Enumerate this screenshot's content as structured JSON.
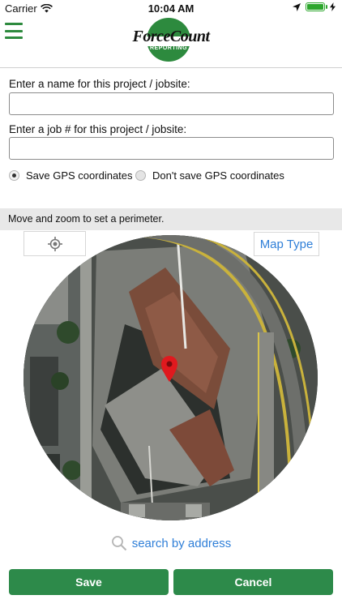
{
  "status_bar": {
    "carrier": "Carrier",
    "time": "10:04 AM",
    "icons": [
      "wifi-icon",
      "location-arrow-icon",
      "battery-icon",
      "charging-bolt-icon"
    ],
    "battery_level": 1.0
  },
  "header": {
    "menu_icon": "hamburger-menu-icon",
    "logo": {
      "title": "ForceCount",
      "subtitle": "REPORTING"
    }
  },
  "form": {
    "name_label": "Enter a name for this project / jobsite:",
    "name_value": "",
    "job_label": "Enter a job # for this project / jobsite:",
    "job_value": "",
    "gps_options": [
      {
        "label": "Save GPS coordinates",
        "selected": true
      },
      {
        "label": "Don't save GPS coordinates",
        "selected": false
      }
    ]
  },
  "map": {
    "instruction": "Move and zoom to set a perimeter.",
    "locate_icon": "locate-crosshair-icon",
    "map_type_label": "Map Type",
    "pin_icon": "map-pin-icon"
  },
  "search": {
    "label": "search by address",
    "icon": "search-icon"
  },
  "actions": {
    "save_label": "Save",
    "cancel_label": "Cancel"
  },
  "colors": {
    "brand_green": "#2d8a3e",
    "button_green": "#2d8a4a",
    "link_blue": "#2f7fd8",
    "info_bar": "#e8e8e8"
  }
}
